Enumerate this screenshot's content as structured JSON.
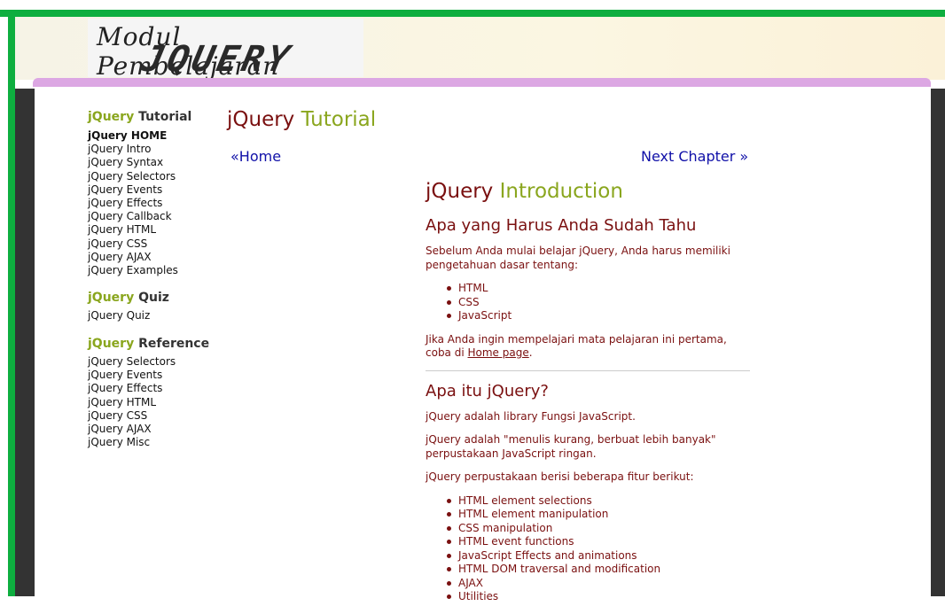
{
  "logo": {
    "script_text": "Modul Pembelajaran",
    "big_text": "JQUERY"
  },
  "sidebar": {
    "tutorial_heading_prefix": "jQuery",
    "tutorial_heading_rest": "Tutorial",
    "tutorial_items": [
      {
        "label": "jQuery HOME"
      },
      {
        "label": "jQuery Intro"
      },
      {
        "label": "jQuery Syntax"
      },
      {
        "label": "jQuery Selectors"
      },
      {
        "label": "jQuery Events"
      },
      {
        "label": "jQuery Effects"
      },
      {
        "label": "jQuery Callback"
      },
      {
        "label": "jQuery HTML"
      },
      {
        "label": "jQuery CSS"
      },
      {
        "label": "jQuery AJAX"
      },
      {
        "label": "jQuery Examples"
      }
    ],
    "quiz_heading_prefix": "jQuery",
    "quiz_heading_rest": "Quiz",
    "quiz_items": [
      {
        "label": "jQuery Quiz"
      }
    ],
    "reference_heading_prefix": "jQuery",
    "reference_heading_rest": "Reference",
    "reference_items": [
      {
        "label": "jQuery Selectors"
      },
      {
        "label": "jQuery Events"
      },
      {
        "label": "jQuery Effects"
      },
      {
        "label": "jQuery HTML"
      },
      {
        "label": "jQuery CSS"
      },
      {
        "label": "jQuery AJAX"
      },
      {
        "label": "jQuery Misc"
      }
    ]
  },
  "page": {
    "title_prefix": "jQuery",
    "title_rest": "Tutorial",
    "prev_link": "«Home",
    "next_link": "Next Chapter »"
  },
  "main": {
    "heading_prefix": "jQuery",
    "heading_rest": "Introduction",
    "section1_title": "Apa yang Harus Anda Sudah Tahu",
    "section1_intro": "Sebelum Anda mulai belajar jQuery, Anda harus memiliki pengetahuan dasar tentang:",
    "section1_list": [
      "HTML",
      "CSS",
      "JavaScript"
    ],
    "section1_outro_before": "Jika Anda ingin mempelajari mata pelajaran ini pertama, coba di ",
    "section1_outro_link": "Home page",
    "section1_outro_after": ".",
    "section2_title": "Apa itu jQuery?",
    "section2_p1": "jQuery adalah library Fungsi JavaScript.",
    "section2_p2": "jQuery adalah \"menulis kurang, berbuat lebih banyak\" perpustakaan JavaScript ringan.",
    "section2_p3": "jQuery perpustakaan berisi beberapa fitur berikut:",
    "section2_list": [
      "HTML element selections",
      "HTML element manipulation",
      "CSS manipulation",
      "HTML event functions",
      "JavaScript Effects and animations",
      "HTML DOM traversal and modification",
      "AJAX",
      "Utilities"
    ]
  }
}
